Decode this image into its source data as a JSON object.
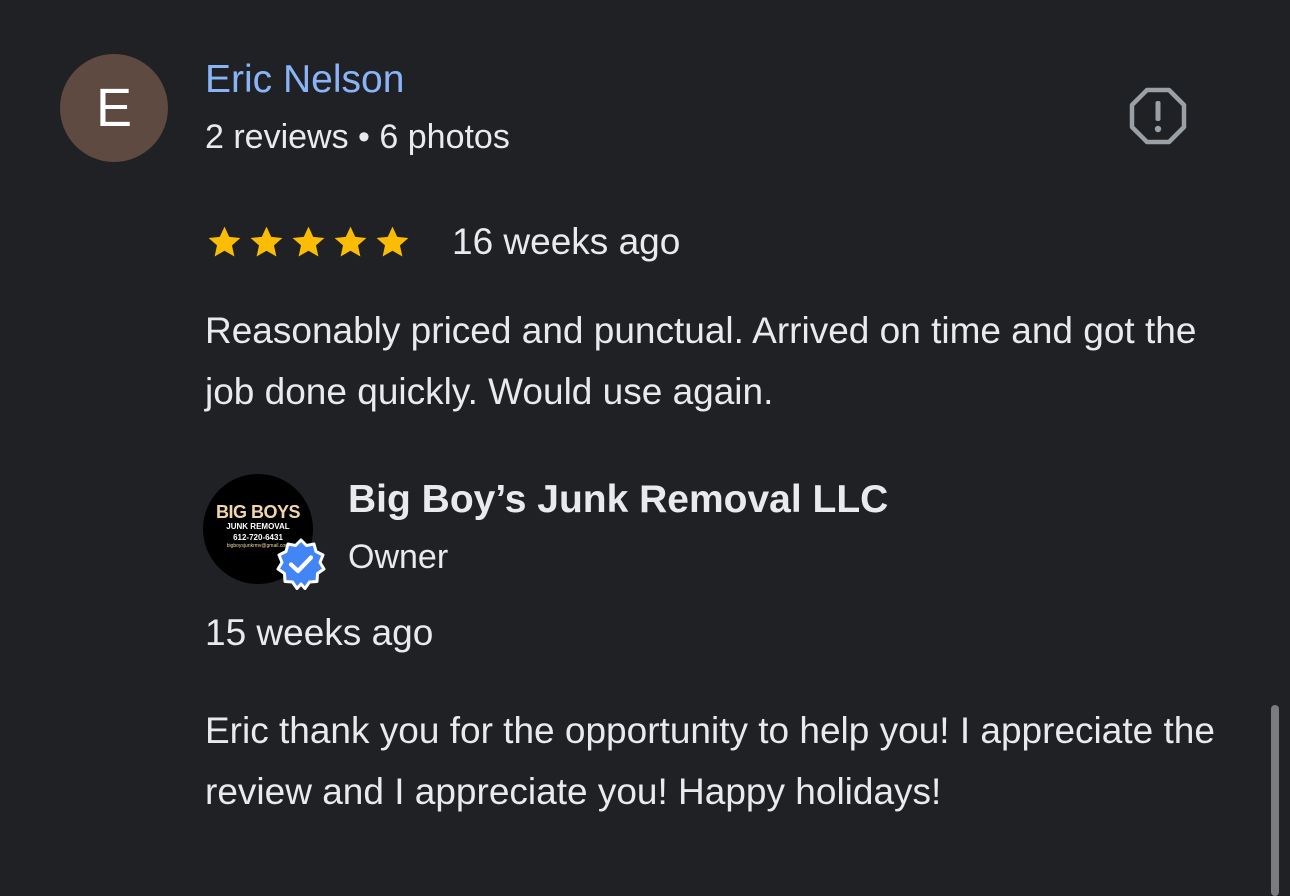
{
  "review": {
    "avatar_letter": "E",
    "reviewer_name": "Eric Nelson",
    "reviewer_meta": "2 reviews • 6 photos",
    "rating": 5,
    "rating_max": 5,
    "date": "16 weeks ago",
    "text": "Reasonably priced and punctual. Arrived on time and got the job done quickly. Would use again.",
    "flag_icon": "report-flag-icon"
  },
  "owner_reply": {
    "logo": {
      "title": "BIG BOYS",
      "subtitle": "JUNK REMOVAL",
      "phone": "612-720-6431",
      "email": "bigboysjunkrmv@gmail.com"
    },
    "name": "Big Boy’s Junk Removal LLC",
    "role": "Owner",
    "date": "15 weeks ago",
    "text": "Eric thank you for the opportunity to help you! I appreciate the review and I appreciate you! Happy holidays!"
  },
  "colors": {
    "background": "#202124",
    "name_link": "#8ab4f8",
    "star": "#fbbc04",
    "verified": "#4285f4",
    "avatar_bg": "#5e4a40"
  }
}
